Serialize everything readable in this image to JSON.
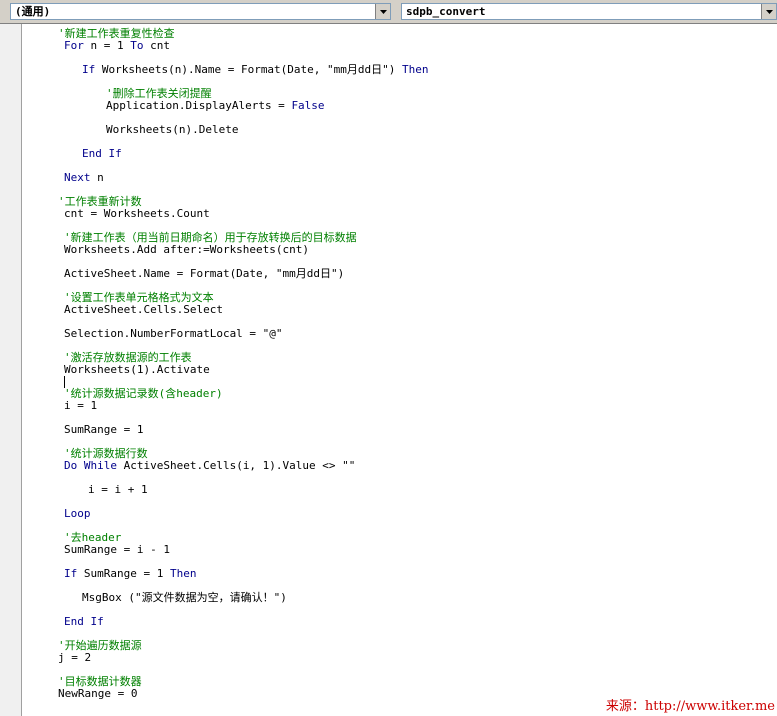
{
  "toolbar": {
    "object_combo": "(通用)",
    "procedure_combo": "sdpb_convert"
  },
  "code_lines": [
    {
      "indent": 1,
      "segments": [
        {
          "t": "'新建工作表重复性检查",
          "s": "c"
        }
      ]
    },
    {
      "indent": 2,
      "segments": [
        {
          "t": "For",
          "s": "k"
        },
        {
          "t": " n = 1 ",
          "s": "n"
        },
        {
          "t": "To",
          "s": "k"
        },
        {
          "t": " cnt",
          "s": "n"
        }
      ]
    },
    {
      "indent": 0,
      "segments": []
    },
    {
      "indent": 3,
      "segments": [
        {
          "t": "If",
          "s": "k"
        },
        {
          "t": " Worksheets(n).Name = Format(Date, \"mm月dd日\") ",
          "s": "n"
        },
        {
          "t": "Then",
          "s": "k"
        }
      ]
    },
    {
      "indent": 0,
      "segments": []
    },
    {
      "indent": 4,
      "segments": [
        {
          "t": "'删除工作表关闭提醒",
          "s": "c"
        }
      ]
    },
    {
      "indent": 4,
      "segments": [
        {
          "t": "Application.DisplayAlerts = ",
          "s": "n"
        },
        {
          "t": "False",
          "s": "k"
        }
      ]
    },
    {
      "indent": 0,
      "segments": []
    },
    {
      "indent": 4,
      "segments": [
        {
          "t": "Worksheets(n).Delete",
          "s": "n"
        }
      ]
    },
    {
      "indent": 0,
      "segments": []
    },
    {
      "indent": 3,
      "segments": [
        {
          "t": "End If",
          "s": "k"
        }
      ]
    },
    {
      "indent": 0,
      "segments": []
    },
    {
      "indent": 2,
      "segments": [
        {
          "t": "Next",
          "s": "k"
        },
        {
          "t": " n",
          "s": "n"
        }
      ]
    },
    {
      "indent": 0,
      "segments": []
    },
    {
      "indent": 1,
      "segments": [
        {
          "t": "'工作表重新计数",
          "s": "c"
        }
      ]
    },
    {
      "indent": 2,
      "segments": [
        {
          "t": "cnt = Worksheets.Count",
          "s": "n"
        }
      ]
    },
    {
      "indent": 0,
      "segments": []
    },
    {
      "indent": 2,
      "segments": [
        {
          "t": "'新建工作表（用当前日期命名）用于存放转换后的目标数据",
          "s": "c"
        }
      ]
    },
    {
      "indent": 2,
      "segments": [
        {
          "t": "Worksheets.Add after:=Worksheets(cnt)",
          "s": "n"
        }
      ]
    },
    {
      "indent": 0,
      "segments": []
    },
    {
      "indent": 2,
      "segments": [
        {
          "t": "ActiveSheet.Name = Format(Date, \"mm月dd日\")",
          "s": "n"
        }
      ]
    },
    {
      "indent": 0,
      "segments": []
    },
    {
      "indent": 2,
      "segments": [
        {
          "t": "'设置工作表单元格格式为文本",
          "s": "c"
        }
      ]
    },
    {
      "indent": 2,
      "segments": [
        {
          "t": "ActiveSheet.Cells.Select",
          "s": "n"
        }
      ]
    },
    {
      "indent": 0,
      "segments": []
    },
    {
      "indent": 2,
      "segments": [
        {
          "t": "Selection.NumberFormatLocal = \"@\"",
          "s": "n"
        }
      ]
    },
    {
      "indent": 0,
      "segments": []
    },
    {
      "indent": 2,
      "segments": [
        {
          "t": "'激活存放数据源的工作表",
          "s": "c"
        }
      ]
    },
    {
      "indent": 2,
      "segments": [
        {
          "t": "Worksheets(1).Activate",
          "s": "n"
        }
      ]
    },
    {
      "indent": 0,
      "segments": []
    },
    {
      "indent": 2,
      "segments": [
        {
          "t": "'统计源数据记录数(含header)",
          "s": "c"
        }
      ]
    },
    {
      "indent": 2,
      "segments": [
        {
          "t": "i = 1",
          "s": "n"
        }
      ]
    },
    {
      "indent": 0,
      "segments": []
    },
    {
      "indent": 2,
      "segments": [
        {
          "t": "SumRange = 1",
          "s": "n"
        }
      ]
    },
    {
      "indent": 0,
      "segments": []
    },
    {
      "indent": 2,
      "segments": [
        {
          "t": "'统计源数据行数",
          "s": "c"
        }
      ]
    },
    {
      "indent": 2,
      "segments": [
        {
          "t": "Do While",
          "s": "k"
        },
        {
          "t": " ActiveSheet.Cells(i, 1).Value <> \"\"",
          "s": "n"
        }
      ]
    },
    {
      "indent": 0,
      "segments": []
    },
    {
      "indent": 5,
      "segments": [
        {
          "t": "i = i + 1",
          "s": "n"
        }
      ]
    },
    {
      "indent": 0,
      "segments": []
    },
    {
      "indent": 2,
      "segments": [
        {
          "t": "Loop",
          "s": "k"
        }
      ]
    },
    {
      "indent": 0,
      "segments": []
    },
    {
      "indent": 2,
      "segments": [
        {
          "t": "'去header",
          "s": "c"
        }
      ]
    },
    {
      "indent": 2,
      "segments": [
        {
          "t": "SumRange = i - 1",
          "s": "n"
        }
      ]
    },
    {
      "indent": 0,
      "segments": []
    },
    {
      "indent": 2,
      "segments": [
        {
          "t": "If",
          "s": "k"
        },
        {
          "t": " SumRange = 1 ",
          "s": "n"
        },
        {
          "t": "Then",
          "s": "k"
        }
      ]
    },
    {
      "indent": 0,
      "segments": []
    },
    {
      "indent": 3,
      "segments": [
        {
          "t": "MsgBox (\"源文件数据为空，请确认！\")",
          "s": "n"
        }
      ]
    },
    {
      "indent": 0,
      "segments": []
    },
    {
      "indent": 2,
      "segments": [
        {
          "t": "End If",
          "s": "k"
        }
      ]
    },
    {
      "indent": 0,
      "segments": []
    },
    {
      "indent": 1,
      "segments": [
        {
          "t": "'开始遍历数据源",
          "s": "c"
        }
      ]
    },
    {
      "indent": 1,
      "segments": [
        {
          "t": "j = 2",
          "s": "n"
        }
      ]
    },
    {
      "indent": 0,
      "segments": []
    },
    {
      "indent": 1,
      "segments": [
        {
          "t": "'目标数据计数器",
          "s": "c"
        }
      ]
    },
    {
      "indent": 1,
      "segments": [
        {
          "t": "NewRange = 0",
          "s": "n"
        }
      ]
    }
  ],
  "watermark": "来源：http://www.itker.me",
  "colors": {
    "comment": "#008000",
    "keyword": "#00008b",
    "text": "#000000"
  }
}
